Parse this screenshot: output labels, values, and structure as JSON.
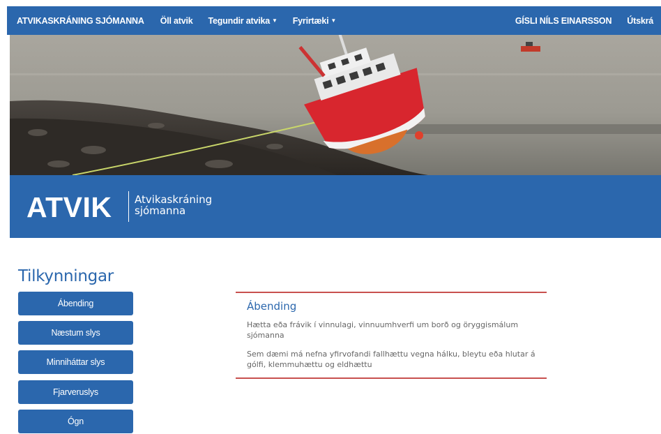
{
  "navbar": {
    "brand": "ATVIKASKRÁNING SJÓMANNA",
    "items": [
      {
        "label": "Öll atvik",
        "dropdown": false
      },
      {
        "label": "Tegundir atvika",
        "dropdown": true
      },
      {
        "label": "Fyrirtæki",
        "dropdown": true
      }
    ],
    "user": "GÍSLI NÍLS EINARSSON",
    "logout": "Útskrá"
  },
  "banner": {
    "logo_main": "ATVIK",
    "logo_sub_line1": "Atvikaskráning",
    "logo_sub_line2": "sjómanna"
  },
  "sidebar": {
    "title": "Tilkynningar",
    "buttons": [
      "Ábending",
      "Næstum slys",
      "Minniháttar slys",
      "Fjarveruslys",
      "Ógn"
    ]
  },
  "panel": {
    "title": "Ábending",
    "text1": "Hætta eða frávik í vinnulagi, vinnuumhverfi um borð og öryggismálum sjómanna",
    "text2": "Sem dæmi má nefna yfirvofandi fallhættu vegna hálku, bleytu eða hlutar á gólfi, klemmuhættu og eldhættu"
  },
  "colors": {
    "primary": "#2b67ad",
    "accent": "#c8504e",
    "text_muted": "#666666"
  }
}
